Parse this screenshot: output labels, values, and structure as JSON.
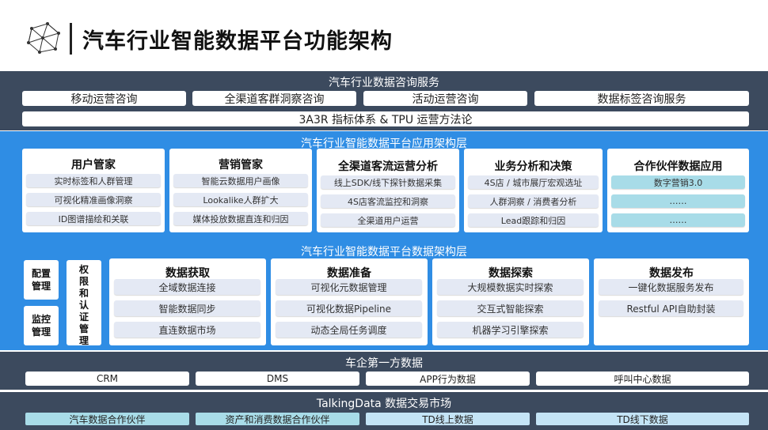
{
  "title": "汽车行业智能数据平台功能架构",
  "consulting": {
    "title": "汽车行业数据咨询服务",
    "items": [
      "移动运营咨询",
      "全渠道客群洞察咨询",
      "活动运营咨询",
      "数据标签咨询服务"
    ],
    "methodology": "3A3R 指标体系 & TPU 运营方法论"
  },
  "app_layer": {
    "title": "汽车行业智能数据平台应用架构层",
    "cards": [
      {
        "title": "用户管家",
        "items": [
          "实时标签和人群管理",
          "可视化精准画像洞察",
          "ID图谱描绘和关联"
        ]
      },
      {
        "title": "营销管家",
        "items": [
          "智能云数据用户画像",
          "Lookalike人群扩大",
          "媒体投放数据直连和归因"
        ]
      },
      {
        "title": "全渠道客流运营分析",
        "items": [
          "线上SDK/线下探针数据采集",
          "4S店客流监控和洞察",
          "全渠道用户运营"
        ]
      },
      {
        "title": "业务分析和决策",
        "items": [
          "4S店 / 城市展厅宏观选址",
          "人群洞察 / 消费者分析",
          "Lead跟踪和归因"
        ]
      },
      {
        "title": "合作伙伴数据应用",
        "items": [
          "数字营销3.0",
          "……",
          "……"
        ]
      }
    ]
  },
  "data_layer": {
    "title": "汽车行业智能数据平台数据架构层",
    "side_a": "配置\n管理",
    "side_b": "监控\n管理",
    "vertical": [
      "权",
      "限",
      "和",
      "认",
      "证",
      "管",
      "理"
    ],
    "cards": [
      {
        "title": "数据获取",
        "items": [
          "全域数据连接",
          "智能数据同步",
          "直连数据市场"
        ]
      },
      {
        "title": "数据准备",
        "items": [
          "可视化元数据管理",
          "可视化数据Pipeline",
          "动态全局任务调度"
        ]
      },
      {
        "title": "数据探索",
        "items": [
          "大规模数据实时探索",
          "交互式智能探索",
          "机器学习引擎探索"
        ]
      },
      {
        "title": "数据发布",
        "items": [
          "一键化数据服务发布",
          "Restful API自助封装"
        ]
      }
    ]
  },
  "first_party": {
    "title": "车企第一方数据",
    "items": [
      "CRM",
      "DMS",
      "APP行为数据",
      "呼叫中心数据"
    ]
  },
  "market": {
    "title": "TalkingData 数据交易市场",
    "items": [
      "汽车数据合作伙伴",
      "资产和消费数据合作伙伴",
      "TD线上数据",
      "TD线下数据"
    ]
  }
}
